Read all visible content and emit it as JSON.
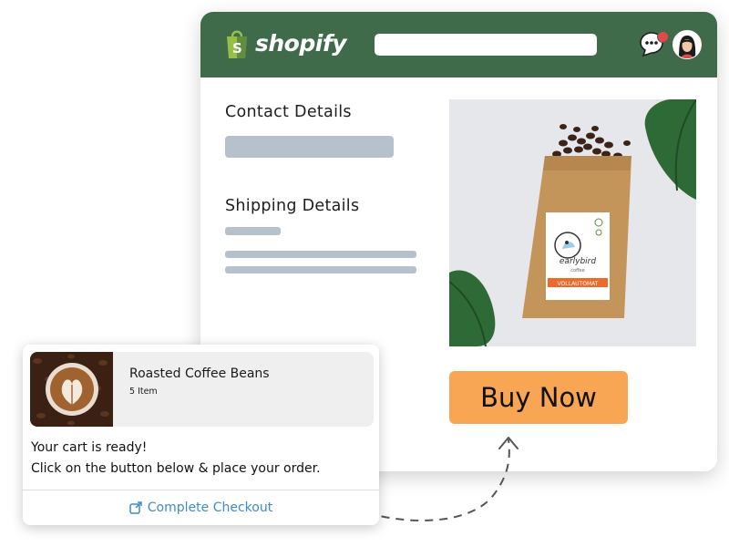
{
  "app": {
    "brand": "shopify",
    "brand_color": "#3f6b4b"
  },
  "header": {
    "search": {
      "placeholder": "",
      "value": ""
    },
    "icons": [
      "chat-icon",
      "avatar"
    ]
  },
  "form": {
    "contact_title": "Contact Details",
    "shipping_title": "Shipping Details"
  },
  "product": {
    "brand": "earlybird",
    "brand_sub": "coffee",
    "label": "VOLLAUTOMAT"
  },
  "actions": {
    "buy_label": "Buy Now",
    "buy_color": "#f9a654"
  },
  "notification": {
    "item_name": "Roasted Coffee Beans",
    "item_qty": "5 Item",
    "line1": "Your cart is ready!",
    "line2": "Click on the button below & place your order.",
    "cta_label": "Complete Checkout",
    "cta_color": "#3d8bc8"
  }
}
